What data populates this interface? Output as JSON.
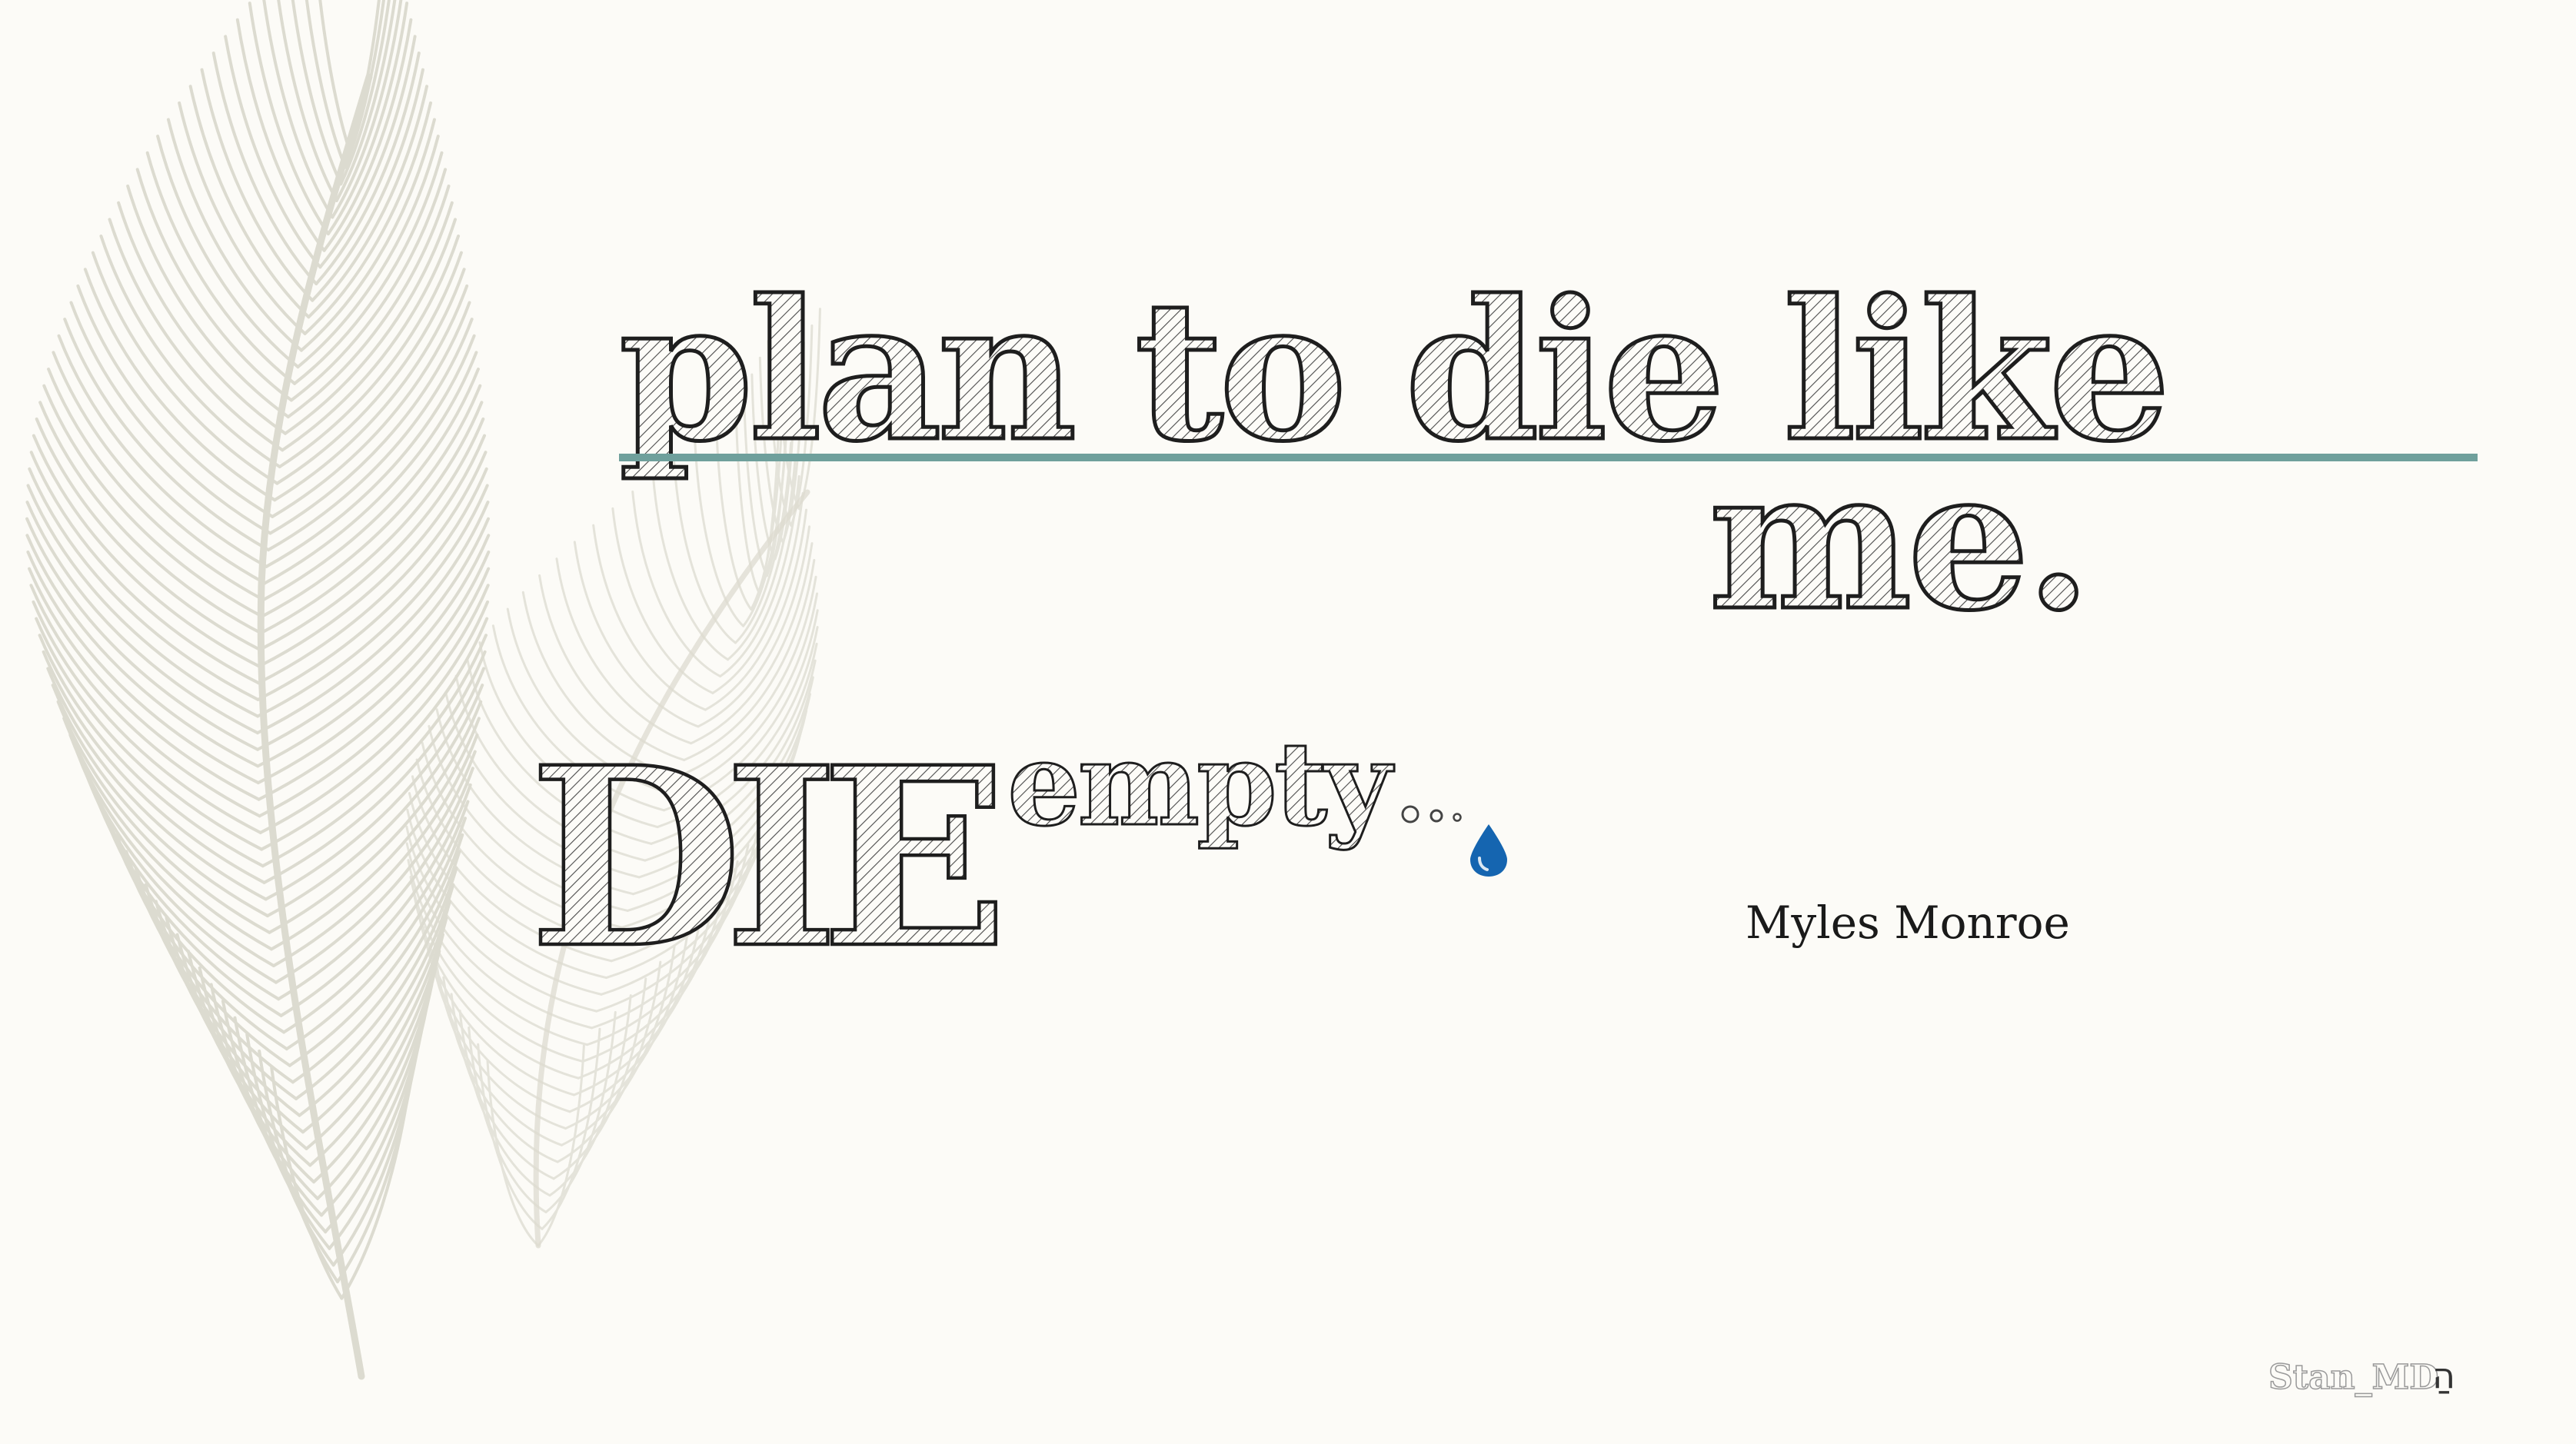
{
  "quote": {
    "line1": "plan to die like",
    "line2": "me.",
    "die": "DIE",
    "empty": "empty",
    "author": "Myles Monroe"
  },
  "signature": {
    "name": "Stan_MD",
    "mark": "הַ"
  },
  "colors": {
    "background": "#fcfbf7",
    "rule": "#6fa09c",
    "feather": "#d9d7cb",
    "drop": "#1565b0",
    "ink": "#1a1a1a"
  },
  "icons": {
    "feather": "feather-icon",
    "drop": "water-drop-icon",
    "dots": "ellipsis-dots"
  }
}
